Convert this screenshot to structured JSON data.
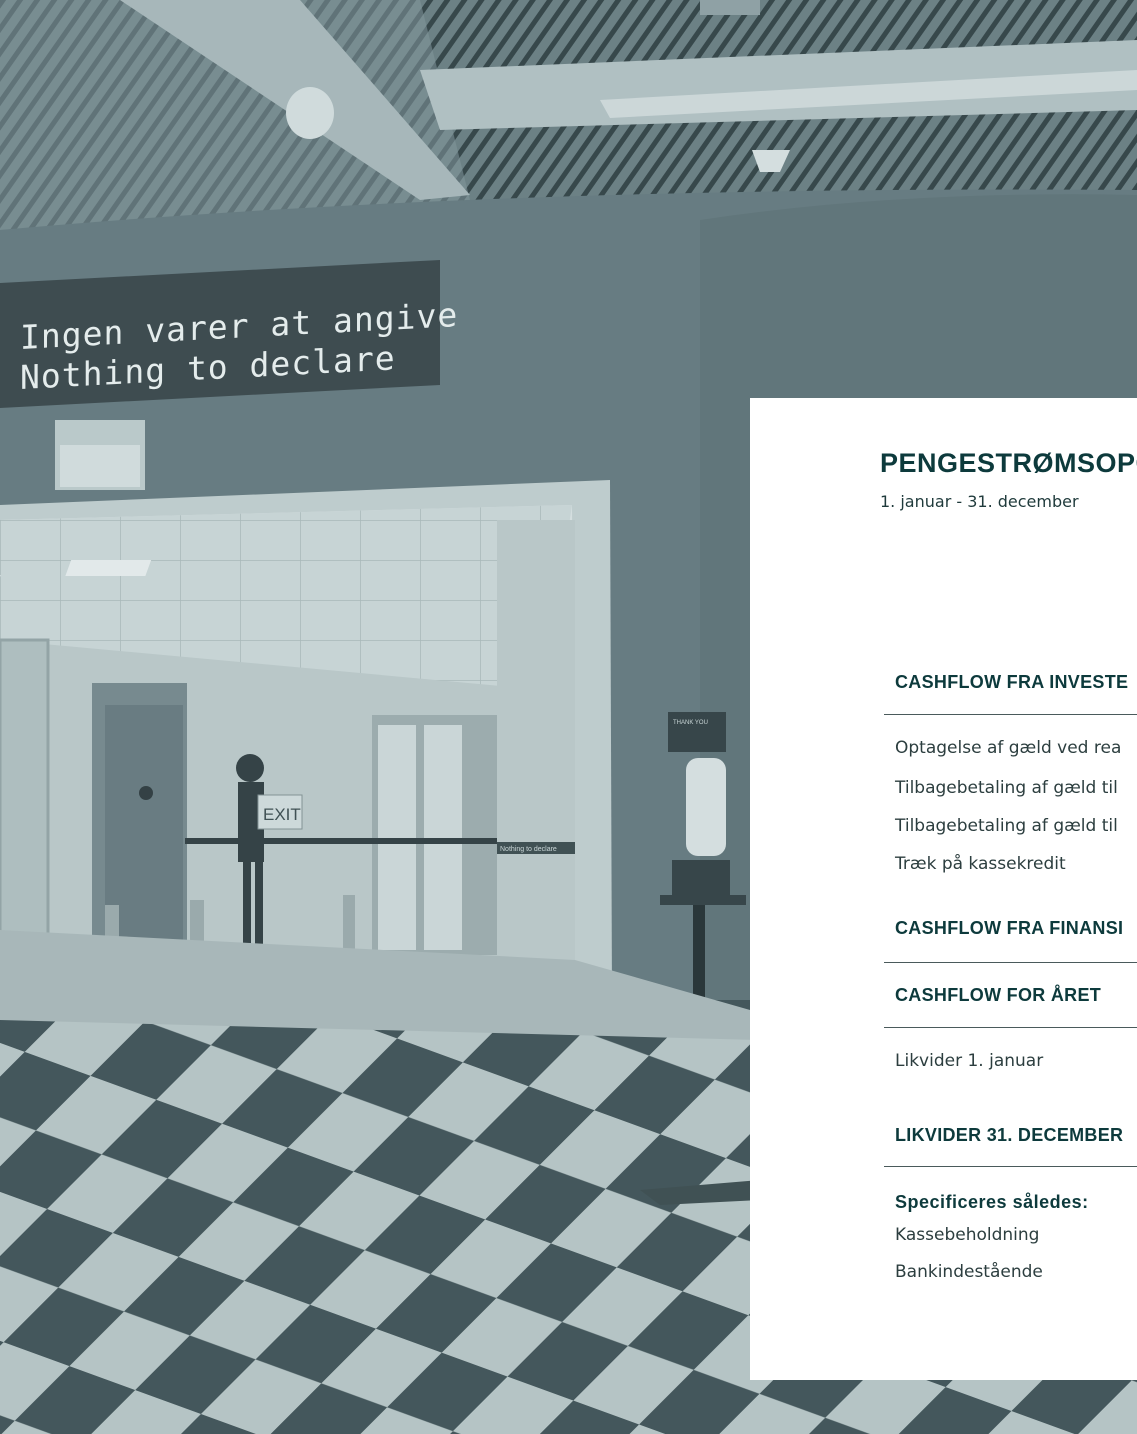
{
  "background": {
    "sign": {
      "line1": "Ingen varer at angive",
      "line2": "Nothing to declare"
    },
    "exit_sign": "EXIT",
    "dispenser_label": "THANK YOU",
    "wall_banner": "Nothing to declare"
  },
  "statement": {
    "title": "PENGESTRØMSOPG",
    "subtitle": "1. januar - 31. december",
    "investing_header": "CASHFLOW FRA INVESTE",
    "rows": [
      "Optagelse af gæld ved rea",
      "Tilbagebetaling af gæld til",
      "Tilbagebetaling af gæld til",
      "Træk på kassekredit"
    ],
    "financing_header": "CASHFLOW FRA FINANSI",
    "year_header": "CASHFLOW FOR ÅRET",
    "opening_cash": "Likvider 1. januar",
    "closing_header": "LIKVIDER 31. DECEMBER",
    "specified_label": "Specificeres således:",
    "cash_on_hand": "Kassebeholdning",
    "bank_deposits": "Bankindestående"
  },
  "colors": {
    "heading": "#0d3a3c",
    "panel": "#ffffff",
    "photo_tint": "#8a9ba0"
  }
}
